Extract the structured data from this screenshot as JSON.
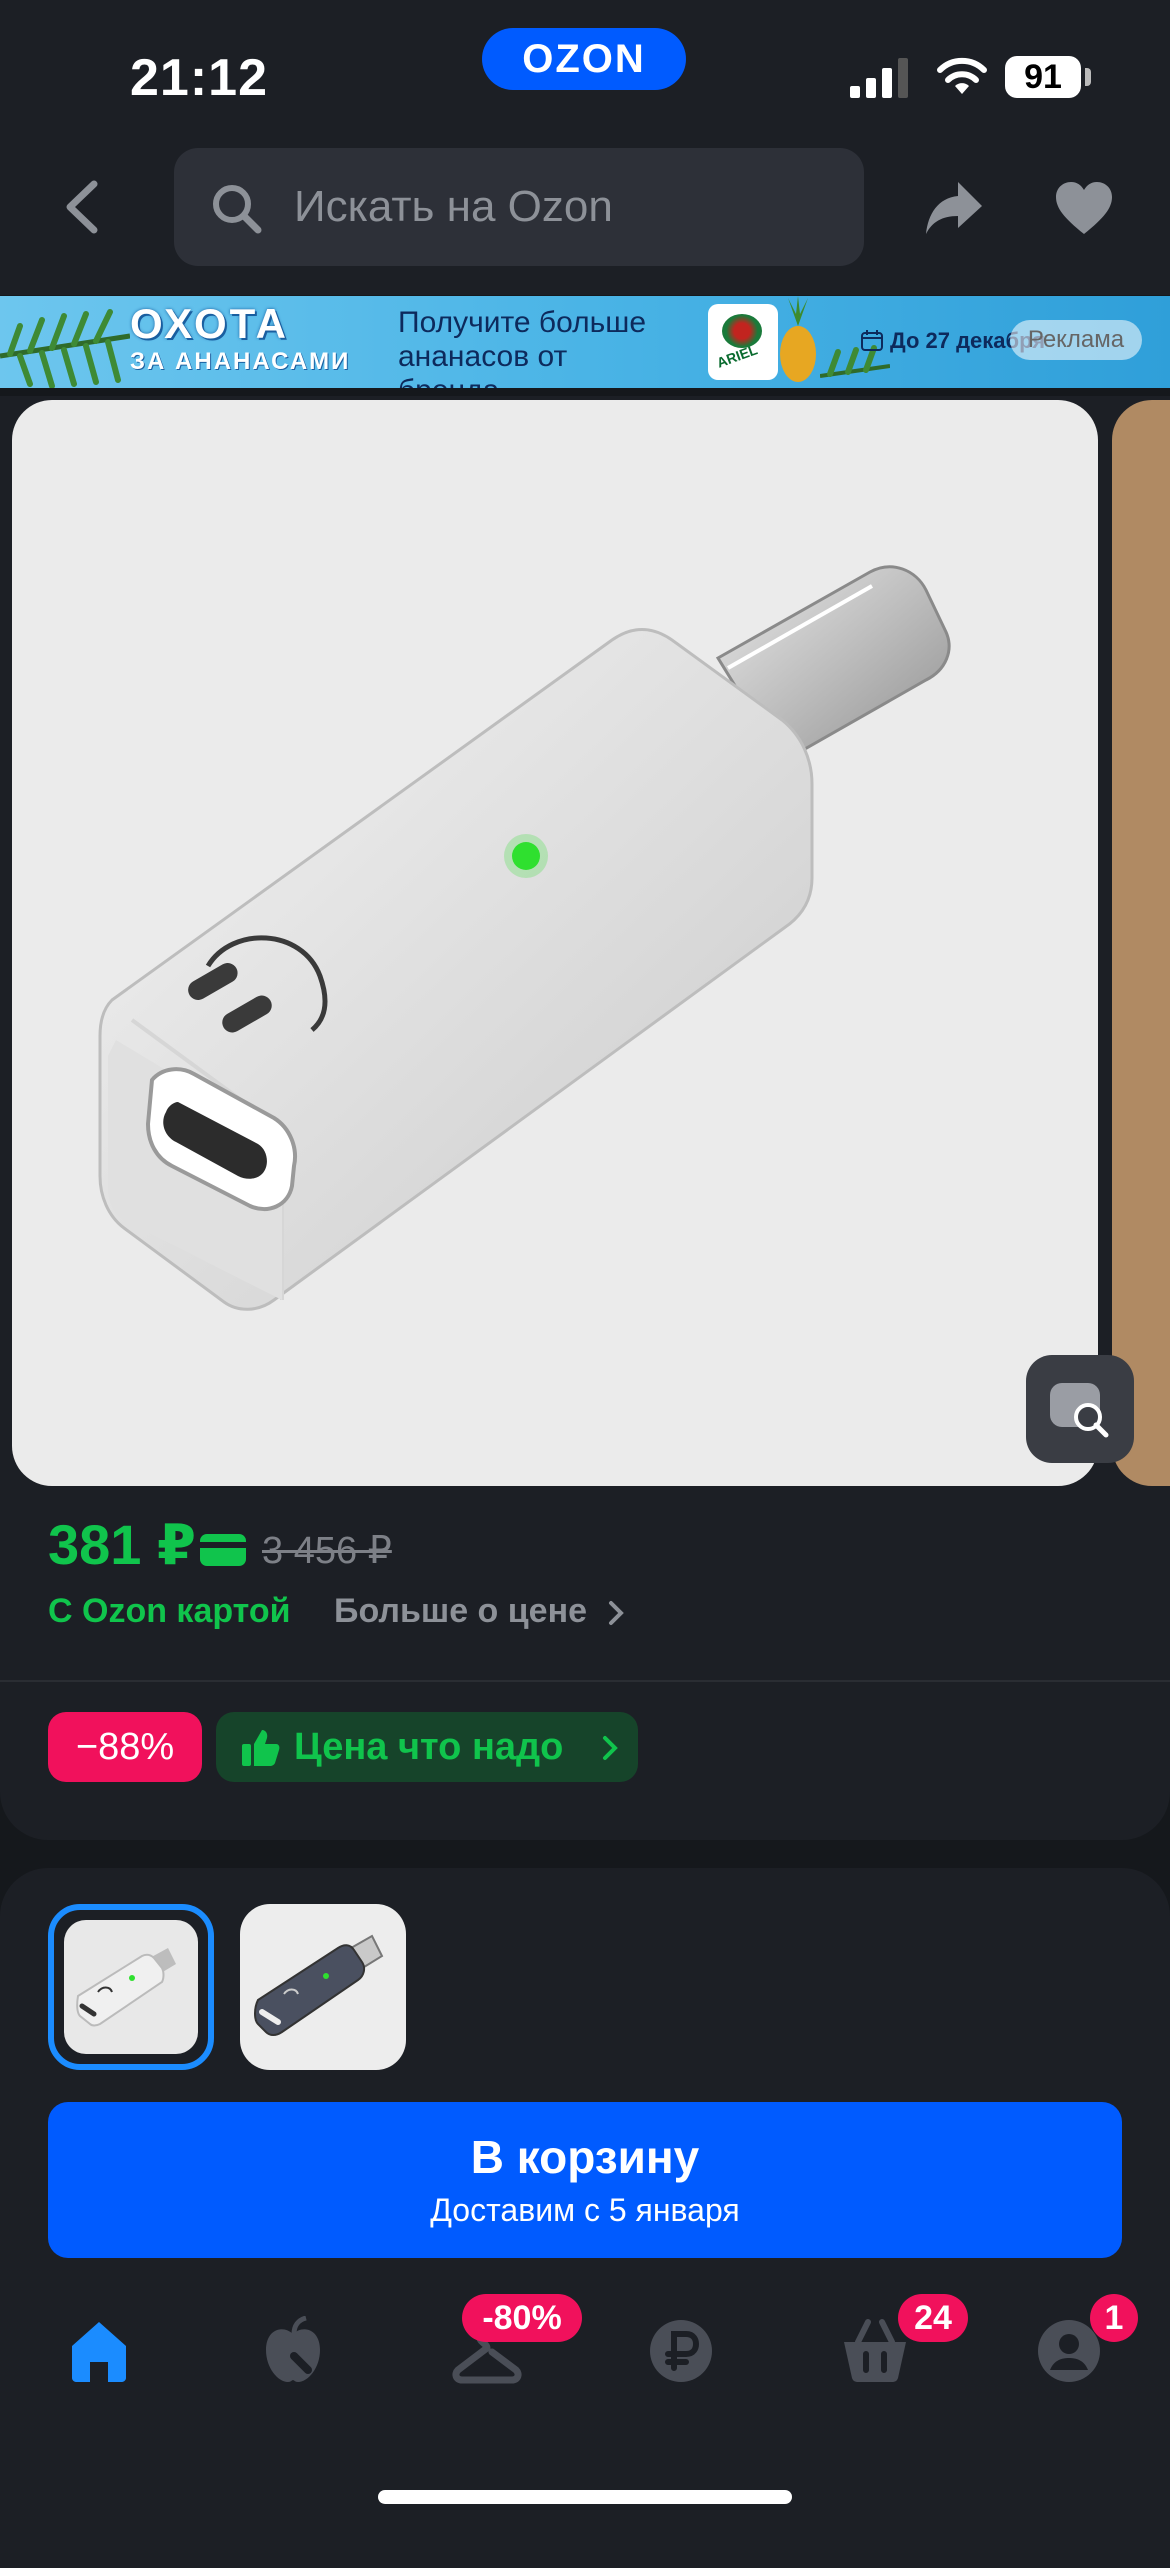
{
  "status_bar": {
    "time": "21:12",
    "brand": "OZON",
    "battery": "91"
  },
  "header": {
    "search_placeholder": "Искать на Ozon"
  },
  "banner": {
    "title_line1": "ОХОТА",
    "title_line2": "ЗА АНАНАСАМИ",
    "text": "Получите больше ананасов от бренда",
    "brand": "ARIEL",
    "date": "До 27 декабря",
    "ad_label": "Реклама"
  },
  "product": {
    "price": "381 ₽",
    "old_price": "3 456 ₽",
    "ozon_card_label": "С Ozon картой",
    "more_price_label": "Больше о цене",
    "discount": "−88%",
    "good_price_label": "Цена что надо"
  },
  "cart": {
    "label": "В корзину",
    "delivery": "Доставим с 5 января"
  },
  "tabbar": {
    "items": [
      {
        "name": "Главная",
        "badge": ""
      },
      {
        "name": "Fresh",
        "badge": ""
      },
      {
        "name": "Одежда",
        "badge": "-80%"
      },
      {
        "name": "Финансы",
        "badge": ""
      },
      {
        "name": "Корзина",
        "badge": "24"
      },
      {
        "name": "Профиль",
        "badge": "1"
      }
    ]
  },
  "colors": {
    "accent": "#005bff",
    "green": "#10c44c",
    "badge": "#f1115c",
    "bg": "#1c1f25"
  }
}
